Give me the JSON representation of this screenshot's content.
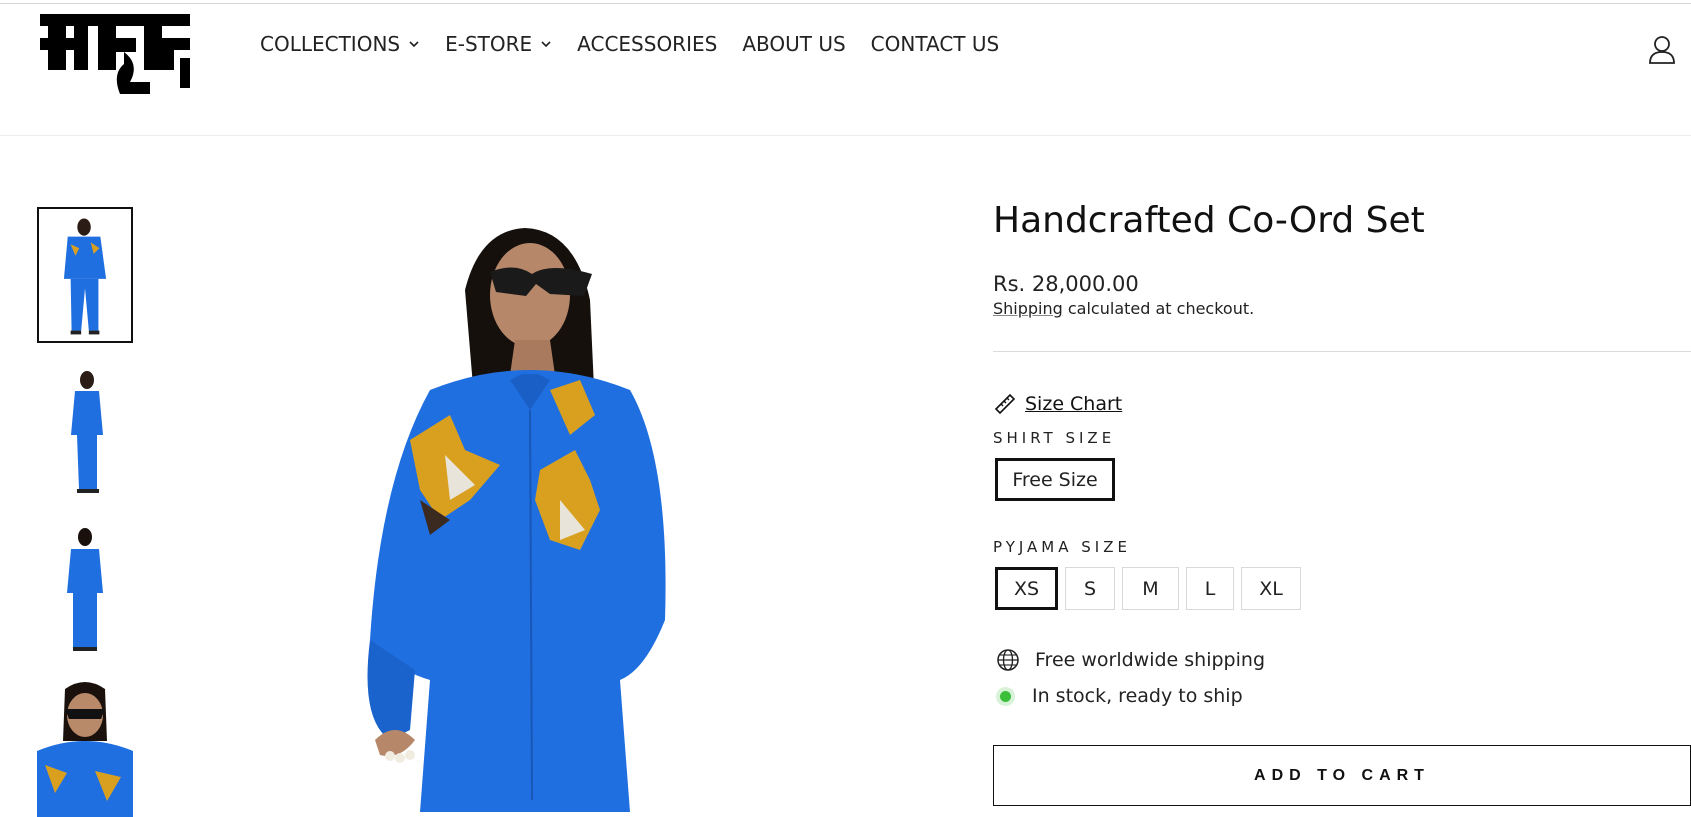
{
  "brand": {
    "logo_text": "कपूर"
  },
  "nav": {
    "items": [
      {
        "label": "COLLECTIONS",
        "has_dropdown": true
      },
      {
        "label": "E-STORE",
        "has_dropdown": true
      },
      {
        "label": "ACCESSORIES",
        "has_dropdown": false
      },
      {
        "label": "ABOUT US",
        "has_dropdown": false
      },
      {
        "label": "CONTACT US",
        "has_dropdown": false
      }
    ],
    "account_icon": "user-icon"
  },
  "gallery": {
    "thumbnails": [
      {
        "icon": "full-length-front-photo",
        "active": true
      },
      {
        "icon": "full-length-side-photo",
        "active": false
      },
      {
        "icon": "full-length-back-photo",
        "active": false
      },
      {
        "icon": "closeup-photo",
        "active": false
      }
    ]
  },
  "product": {
    "title": "Handcrafted Co-Ord Set",
    "price": "Rs. 28,000.00",
    "shipping_link": "Shipping",
    "shipping_note": " calculated at checkout.",
    "size_chart_label": "Size Chart",
    "shirt_size": {
      "label": "SHIRT SIZE",
      "options": [
        "Free Size"
      ],
      "selected": "Free Size"
    },
    "pyjama_size": {
      "label": "PYJAMA SIZE",
      "options": [
        "XS",
        "S",
        "M",
        "L",
        "XL"
      ],
      "selected": "XS"
    },
    "features": [
      {
        "icon": "globe-icon",
        "text": "Free worldwide shipping"
      },
      {
        "icon": "in-stock-dot",
        "text": "In stock, ready to ship"
      }
    ],
    "add_to_cart": "ADD TO CART"
  },
  "colors": {
    "shirt_blue": "#1f6fe0",
    "flower_gold": "#d9a020",
    "stock_green": "#3bbf3b"
  }
}
